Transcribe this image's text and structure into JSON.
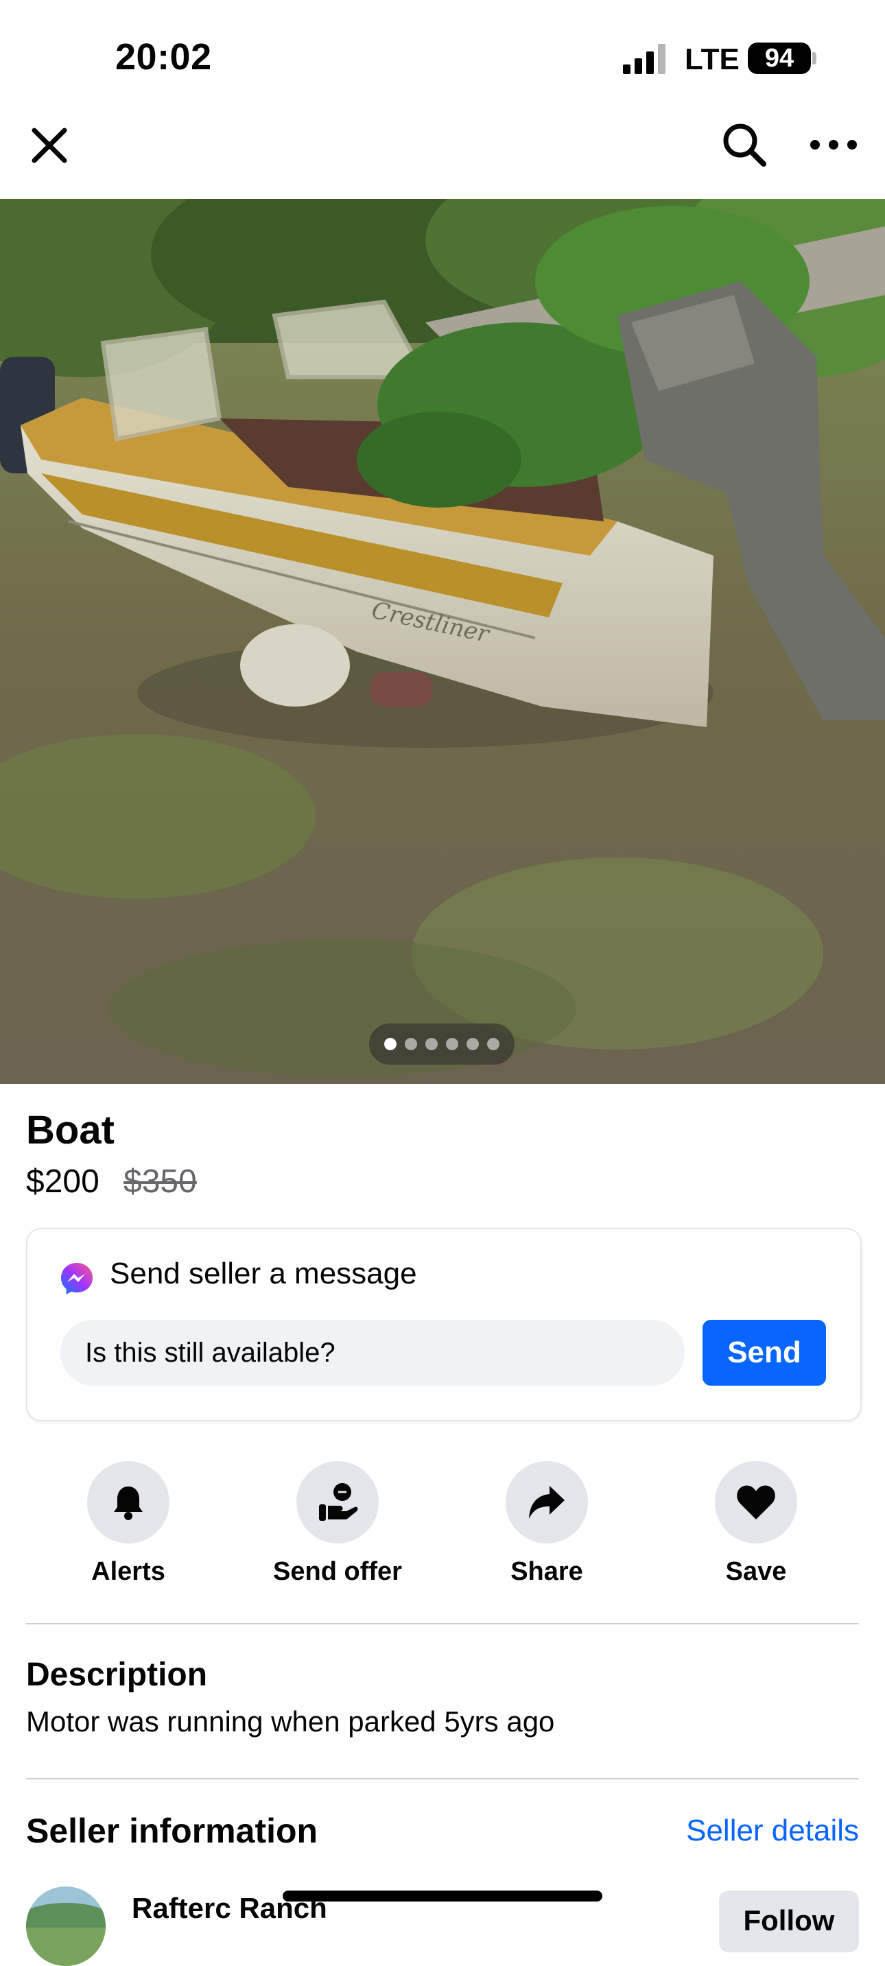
{
  "status_bar": {
    "time": "20:02",
    "network": "LTE",
    "battery": "94"
  },
  "nav": {
    "close_icon": "close-icon",
    "search_icon": "search-icon",
    "more_icon": "more-icon"
  },
  "listing": {
    "title": "Boat",
    "price": "$200",
    "original_price": "$350",
    "photo_count": 6,
    "active_photo": 1
  },
  "message": {
    "title": "Send seller a message",
    "input_value": "Is this still available?",
    "send_label": "Send"
  },
  "actions": [
    {
      "label": "Alerts",
      "icon": "bell-icon"
    },
    {
      "label": "Send offer",
      "icon": "offer-icon"
    },
    {
      "label": "Share",
      "icon": "share-arrow-icon"
    },
    {
      "label": "Save",
      "icon": "heart-icon"
    }
  ],
  "description": {
    "heading": "Description",
    "text": "Motor was running when parked 5yrs ago"
  },
  "seller": {
    "heading": "Seller information",
    "details_link": "Seller details",
    "name": "Rafterc Ranch",
    "follow_label": "Follow"
  },
  "colors": {
    "accent": "#0866ff",
    "muted": "#65676b",
    "chip": "#e4e6eb"
  }
}
